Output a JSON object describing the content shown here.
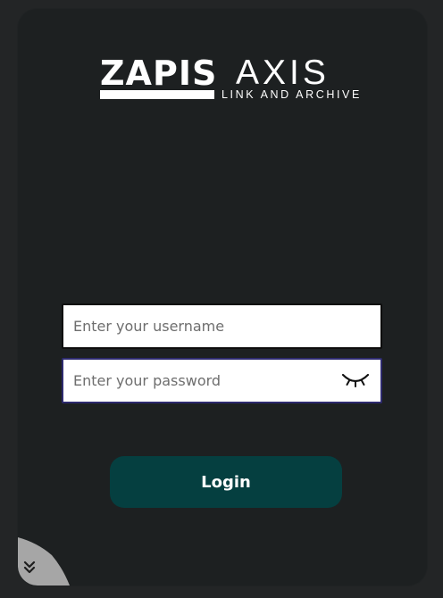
{
  "logo": {
    "brand_bold": "ZAPIS",
    "brand_light": "AXIS",
    "tagline": "LINK AND ARCHIVE"
  },
  "form": {
    "username_placeholder": "Enter your username",
    "username_value": "",
    "password_placeholder": "Enter your password",
    "password_value": "",
    "login_label": "Login"
  },
  "icons": {
    "password_toggle": "eye-closed-icon",
    "corner_expand": "double-chevron-down-icon"
  },
  "colors": {
    "page_background": "#232526",
    "card_background": "#1d2021",
    "button_background": "#053f40",
    "password_focus_border": "#2d2a6e",
    "corner_fold": "#a6a6a6"
  }
}
